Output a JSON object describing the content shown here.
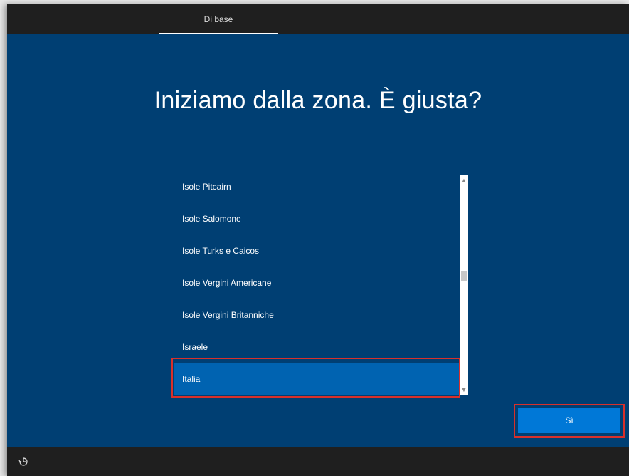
{
  "header": {
    "tabs": [
      {
        "label": "Di base",
        "active": true
      }
    ]
  },
  "main": {
    "title": "Iniziamo dalla zona. È giusta?",
    "region_list": {
      "items": [
        {
          "label": "Isole Pitcairn",
          "selected": false
        },
        {
          "label": "Isole Salomone",
          "selected": false
        },
        {
          "label": "Isole Turks e Caicos",
          "selected": false
        },
        {
          "label": "Isole Vergini Americane",
          "selected": false
        },
        {
          "label": "Isole Vergini Britanniche",
          "selected": false
        },
        {
          "label": "Israele",
          "selected": false
        },
        {
          "label": "Italia",
          "selected": true
        }
      ]
    },
    "confirm_button": {
      "label": "Sì"
    }
  },
  "footer": {
    "accessibility_icon": "ease-of-access-icon"
  },
  "colors": {
    "background": "#003f73",
    "bar": "#1f1f1f",
    "selected_item": "#0063b1",
    "button": "#0078d7",
    "annotation": "#d9302b"
  }
}
